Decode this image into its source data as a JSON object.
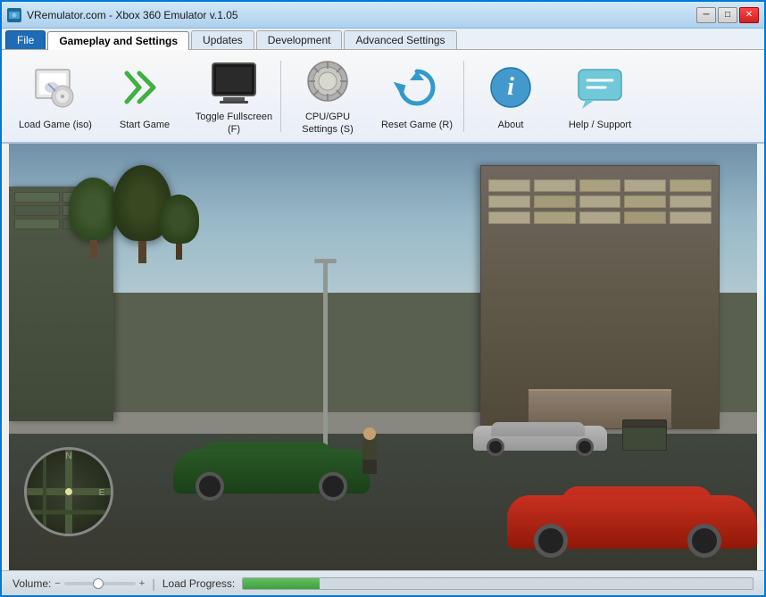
{
  "window": {
    "title": "VRemulator.com - Xbox 360 Emulator v.1.05",
    "minimize_label": "─",
    "maximize_label": "□",
    "close_label": "✕"
  },
  "tabs": {
    "file_label": "File",
    "gameplay_label": "Gameplay and Settings",
    "updates_label": "Updates",
    "development_label": "Development",
    "advanced_label": "Advanced Settings"
  },
  "toolbar": {
    "load_game_label": "Load Game (iso)",
    "start_game_label": "Start Game",
    "toggle_fullscreen_label": "Toggle Fullscreen (F)",
    "cpu_gpu_settings_label": "CPU/GPU Settings (S)",
    "reset_game_label": "Reset Game (R)",
    "about_label": "About",
    "help_support_label": "Help / Support"
  },
  "statusbar": {
    "volume_label": "Volume:",
    "load_progress_label": "Load Progress:",
    "progress_percent": 15
  }
}
